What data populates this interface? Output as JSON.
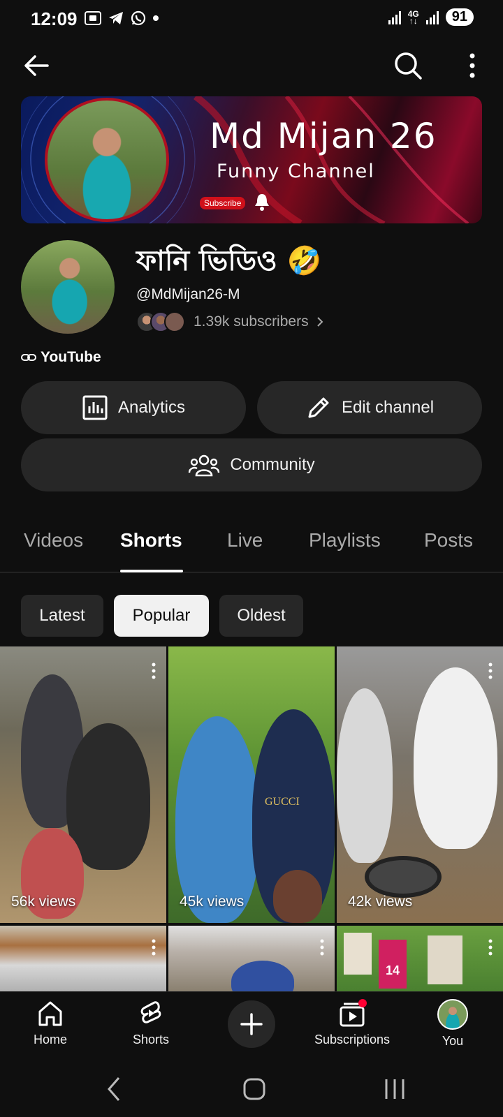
{
  "status_bar": {
    "time": "12:09",
    "network": "4G",
    "battery": "91"
  },
  "banner": {
    "title": "Md Mijan 26",
    "subtitle": "Funny Channel",
    "subscribe_label": "Subscribe"
  },
  "channel": {
    "name": "ফানি ভিডিও 🤣",
    "handle": "@MdMijan26-M",
    "subscribers": "1.39k subscribers",
    "link": "YouTube"
  },
  "actions": {
    "analytics": "Analytics",
    "edit": "Edit channel",
    "community": "Community"
  },
  "tabs": [
    "Videos",
    "Shorts",
    "Live",
    "Playlists",
    "Posts"
  ],
  "active_tab": "Shorts",
  "chips": [
    "Latest",
    "Popular",
    "Oldest"
  ],
  "selected_chip": "Popular",
  "shorts": [
    {
      "views": "56k views"
    },
    {
      "views": "45k views",
      "shirt_text": "GUCCI"
    },
    {
      "views": "42k views"
    },
    {
      "views": ""
    },
    {
      "views": ""
    },
    {
      "views": "",
      "sign_text": "14"
    }
  ],
  "bottom_nav": {
    "home": "Home",
    "shorts": "Shorts",
    "subscriptions": "Subscriptions",
    "you": "You"
  },
  "colors": {
    "background": "#0f0f0f",
    "pill": "#272727",
    "accent_red": "#ff0033"
  }
}
